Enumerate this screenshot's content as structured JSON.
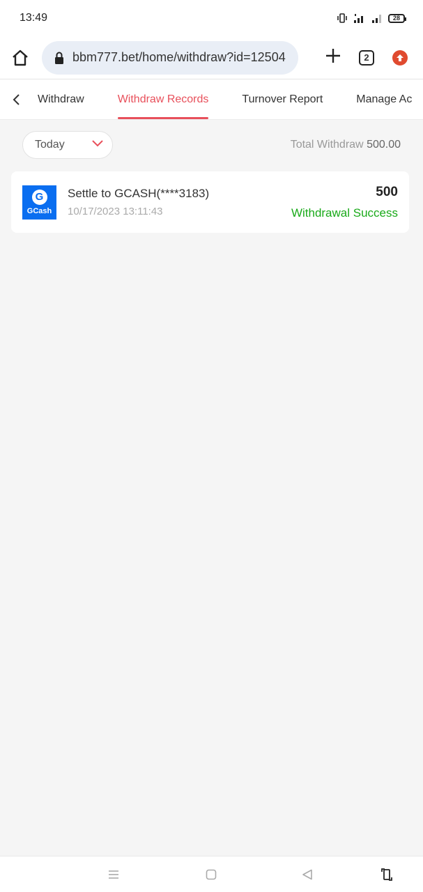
{
  "status_bar": {
    "time": "13:49",
    "battery": "28",
    "icons": [
      "vibrate-icon",
      "wifi-icon",
      "signal-icon",
      "battery-icon"
    ]
  },
  "browser": {
    "url": "bbm777.bet/home/withdraw?id=12504",
    "tab_count": "2",
    "icons": [
      "home-icon",
      "lock-icon",
      "plus-icon",
      "tab-count-icon",
      "update-icon"
    ]
  },
  "tabs": [
    {
      "label": "Withdraw",
      "active": false
    },
    {
      "label": "Withdraw Records",
      "active": true
    },
    {
      "label": "Turnover Report",
      "active": false
    },
    {
      "label": "Manage Ac",
      "active": false
    }
  ],
  "filter": {
    "date_range": "Today",
    "total_label": "Total Withdraw",
    "total_value": "500.00"
  },
  "records": [
    {
      "logo_text": "GCash",
      "logo_letter": "G",
      "title": "Settle to GCASH(****3183)",
      "datetime": "10/17/2023 13:11:43",
      "amount": "500",
      "status": "Withdrawal Success"
    }
  ],
  "colors": {
    "accent": "#e8505b",
    "success": "#1aaa1a",
    "gcash_blue": "#0a6ef0",
    "background": "#f5f5f5"
  },
  "navigation": [
    "menu-icon",
    "home-square-icon",
    "back-triangle-icon",
    "rotate-icon"
  ]
}
